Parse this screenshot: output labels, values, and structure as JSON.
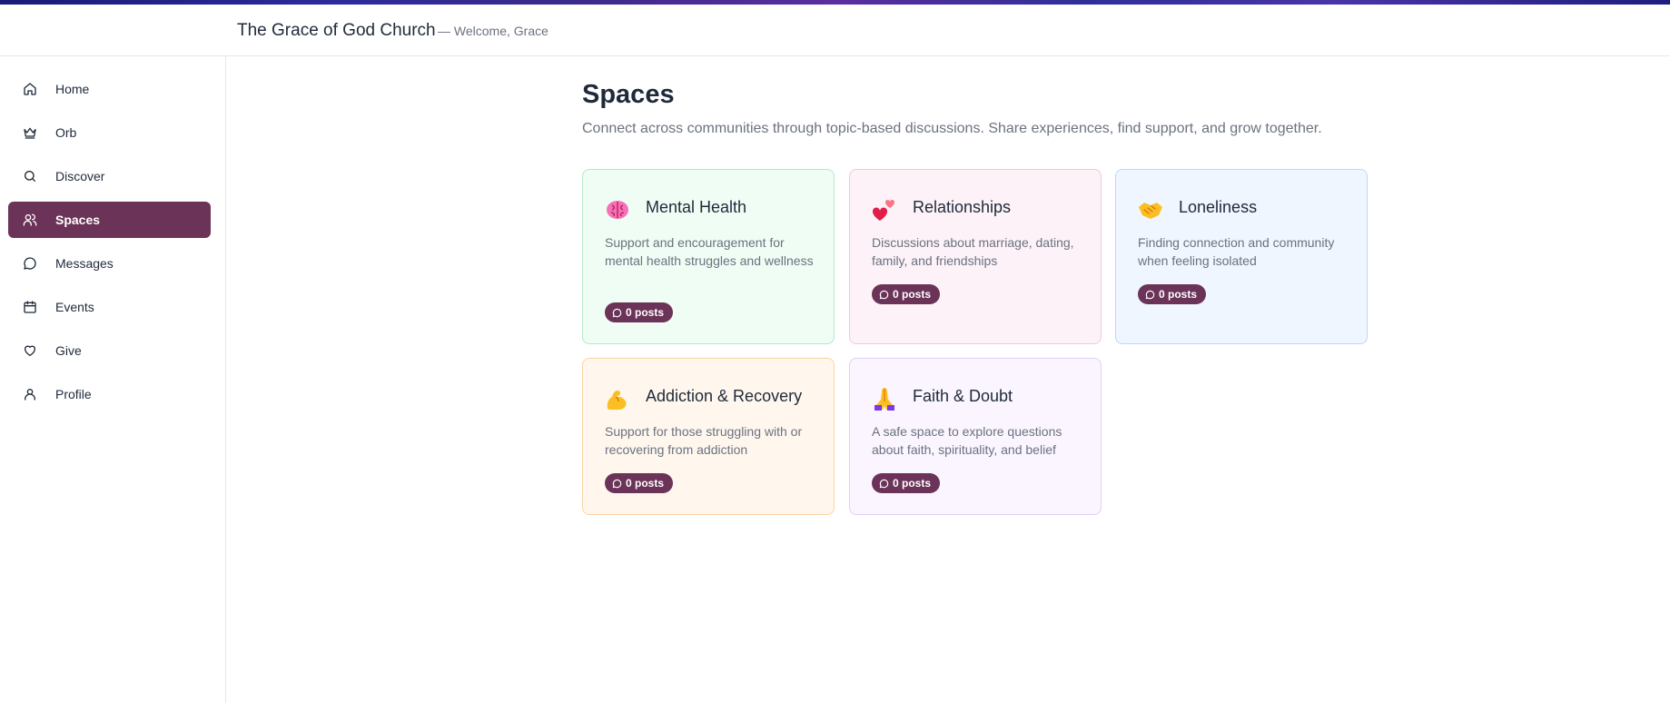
{
  "header": {
    "church_name": "The Grace of God Church",
    "welcome": "— Welcome, Grace"
  },
  "sidebar": {
    "items": [
      {
        "label": "Home",
        "icon": "home-icon",
        "active": false
      },
      {
        "label": "Orb",
        "icon": "crown-icon",
        "active": false
      },
      {
        "label": "Discover",
        "icon": "search-icon",
        "active": false
      },
      {
        "label": "Spaces",
        "icon": "users-icon",
        "active": true
      },
      {
        "label": "Messages",
        "icon": "message-circle-icon",
        "active": false
      },
      {
        "label": "Events",
        "icon": "calendar-icon",
        "active": false
      },
      {
        "label": "Give",
        "icon": "heart-icon",
        "active": false
      },
      {
        "label": "Profile",
        "icon": "user-icon",
        "active": false
      }
    ]
  },
  "main": {
    "title": "Spaces",
    "subtitle": "Connect across communities through topic-based discussions. Share experiences, find support, and grow together.",
    "spaces": [
      {
        "emoji": "🧠",
        "icon": "brain-icon",
        "title": "Mental Health",
        "description": "Support and encouragement for mental health struggles and wellness",
        "posts": "0 posts",
        "bg": "#f0fdf4",
        "border": "#b5e8c6"
      },
      {
        "emoji": "💞",
        "icon": "hearts-icon",
        "title": "Relationships",
        "description": "Discussions about marriage, dating, family, and friendships",
        "posts": "0 posts",
        "bg": "#fdf2f8",
        "border": "#f6c5dc"
      },
      {
        "emoji": "🤝",
        "icon": "handshake-icon",
        "title": "Loneliness",
        "description": "Finding connection and community when feeling isolated",
        "posts": "0 posts",
        "bg": "#eff6ff",
        "border": "#bcd7f7"
      },
      {
        "emoji": "💪",
        "icon": "flexed-bicep-icon",
        "title": "Addiction & Recovery",
        "description": "Support for those struggling with or recovering from addiction",
        "posts": "0 posts",
        "bg": "#fff7ed",
        "border": "#fbd3a6"
      },
      {
        "emoji": "🙏",
        "icon": "praying-hands-icon",
        "title": "Faith & Doubt",
        "description": "A safe space to explore questions about faith, spirituality, and belief",
        "posts": "0 posts",
        "bg": "#faf5ff",
        "border": "#dfd0f7"
      }
    ]
  },
  "colors": {
    "accent": "#6b3358",
    "text": "#1e2a3b",
    "muted": "#6b7280"
  }
}
